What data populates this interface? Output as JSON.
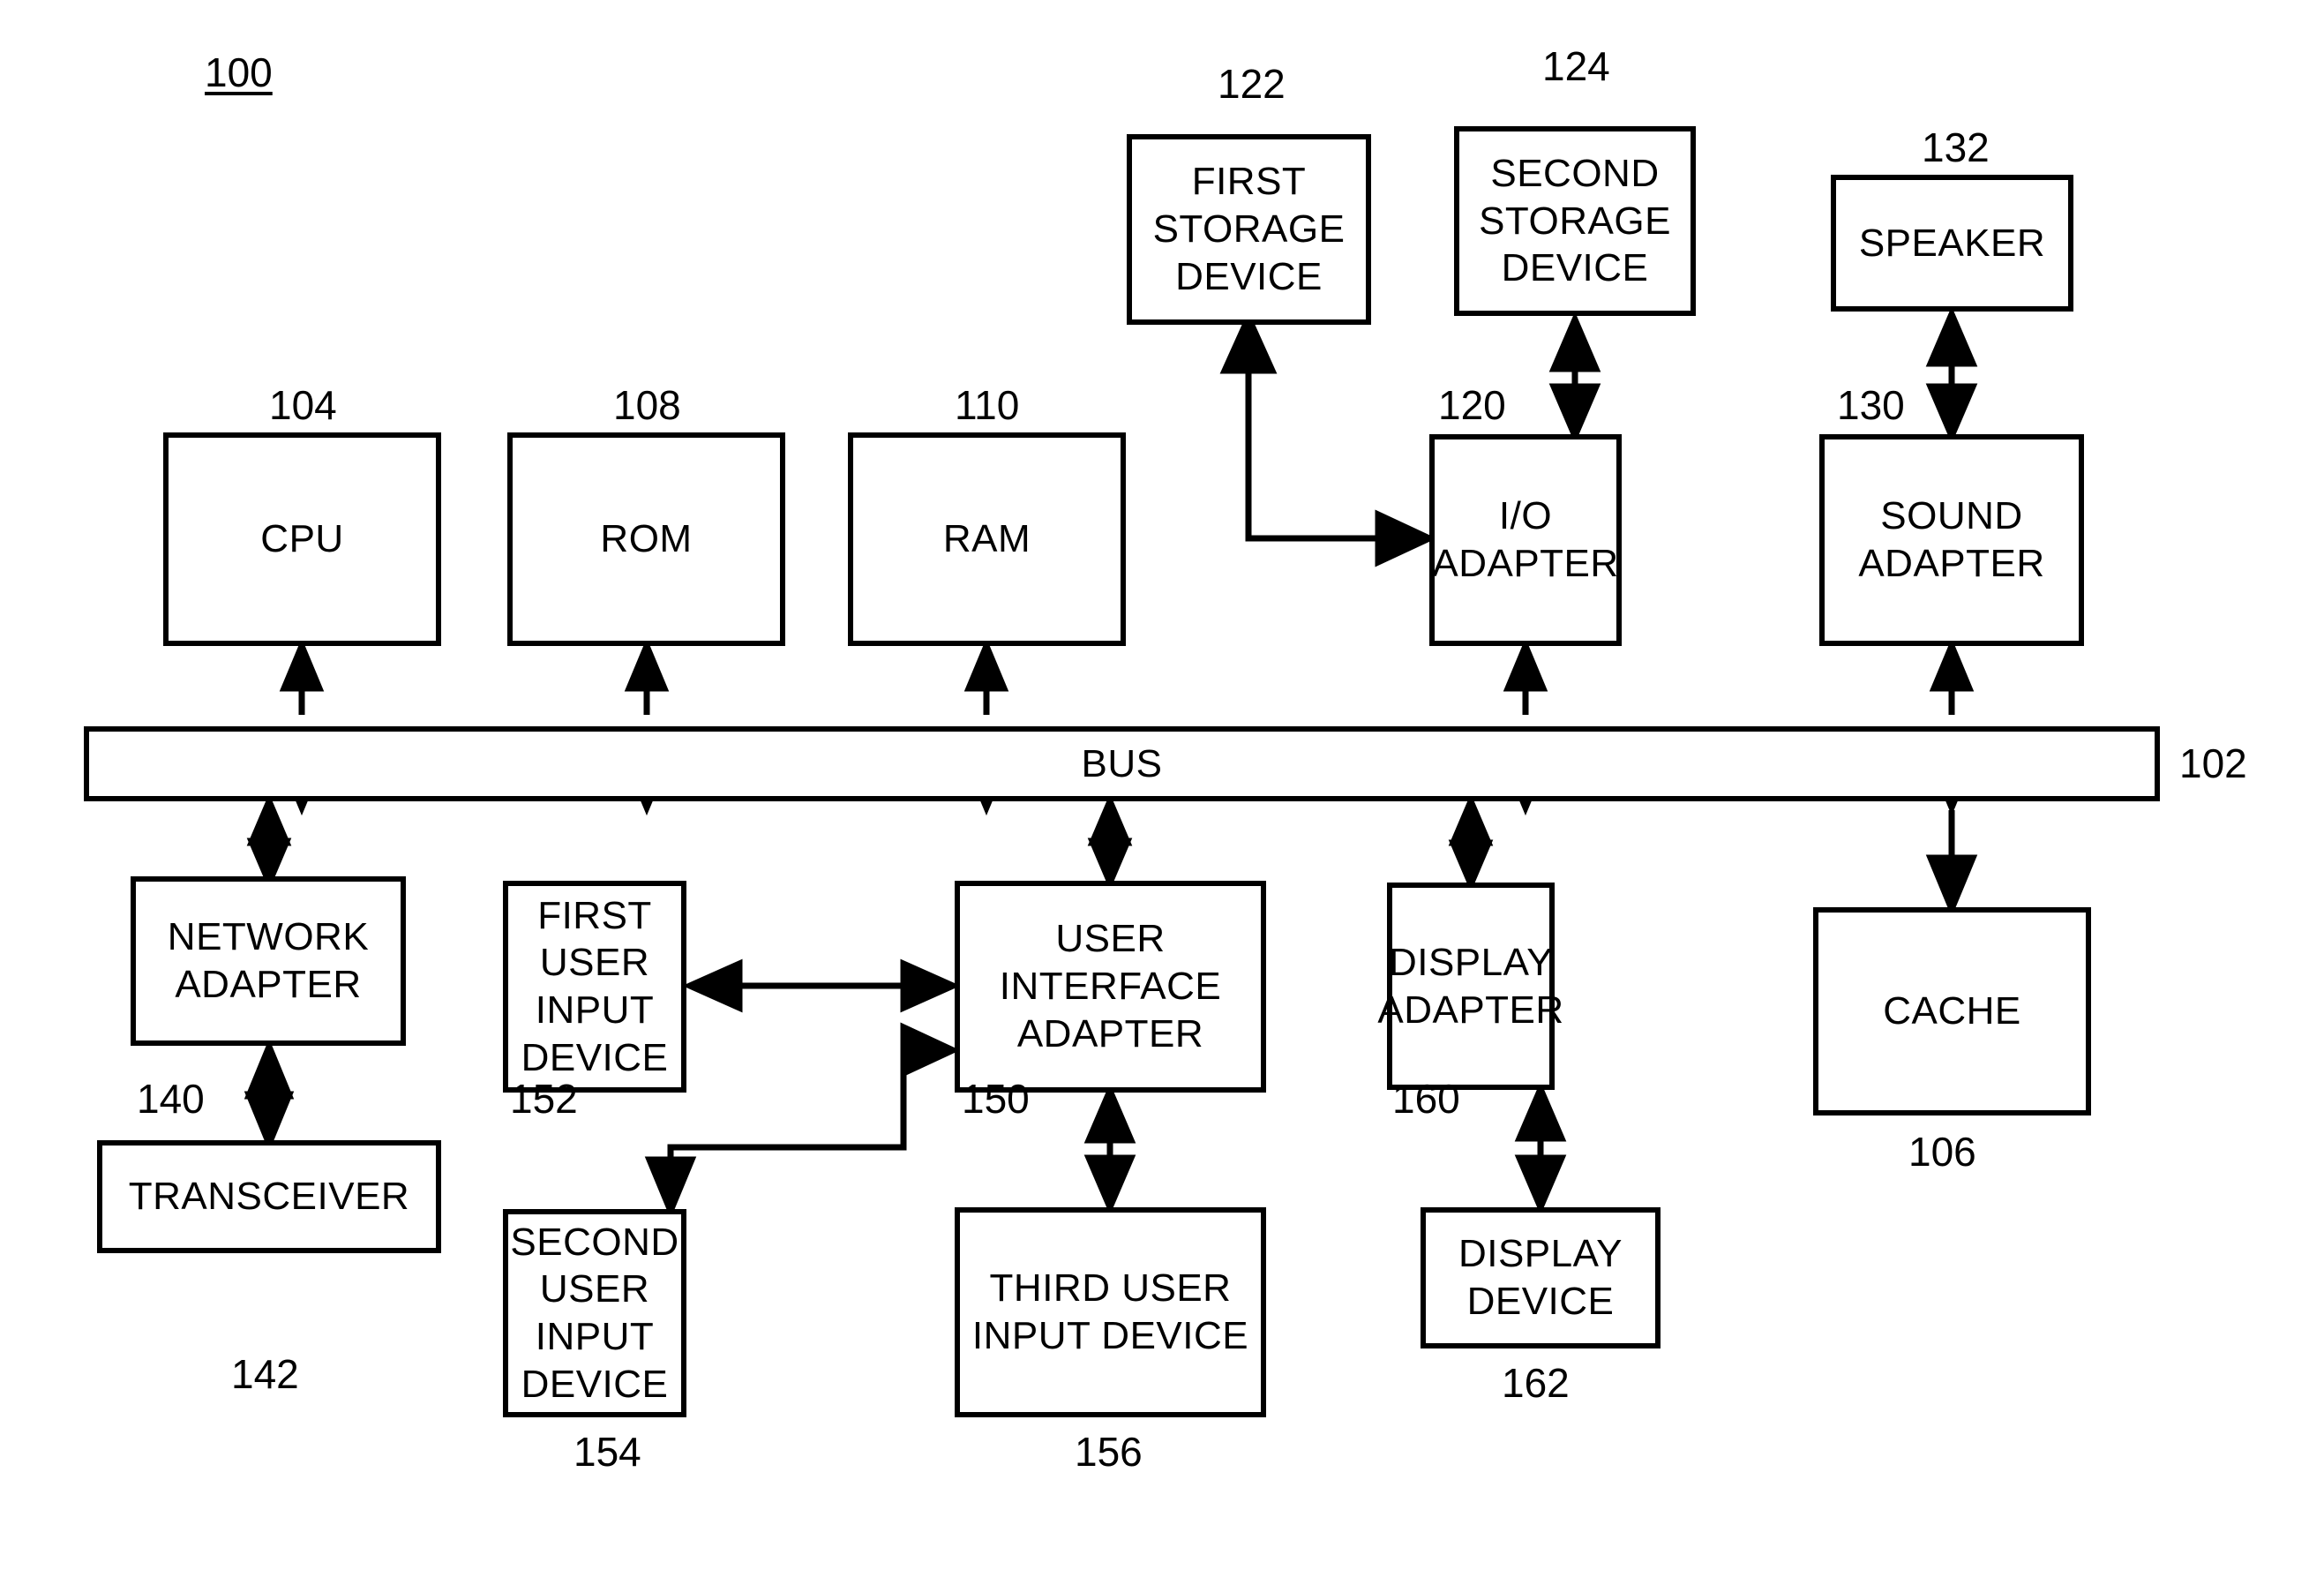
{
  "figure": {
    "figure_label": "100",
    "background_color": "#ffffff",
    "line_color": "#000000"
  },
  "nodes": {
    "first_storage_device": "FIRST\nSTORAGE\nDEVICE",
    "second_storage_device": "SECOND\nSTORAGE\nDEVICE",
    "speaker": "SPEAKER",
    "cpu": "CPU",
    "rom": "ROM",
    "ram": "RAM",
    "io_adapter": "I/O\nADAPTER",
    "sound_adapter": "SOUND\nADAPTER",
    "bus": "BUS",
    "network_adapter": "NETWORK\nADAPTER",
    "first_user_input_device": "FIRST USER\nINPUT DEVICE",
    "user_interface_adapter": "USER\nINTERFACE\nADAPTER",
    "display_adapter": "DISPLAY\nADAPTER",
    "cache": "CACHE",
    "transceiver": "TRANSCEIVER",
    "second_user_input_device": "SECOND USER\nINPUT DEVICE",
    "third_user_input_device": "THIRD USER\nINPUT DEVICE",
    "display_device": "DISPLAY\nDEVICE"
  },
  "refs": {
    "first_storage_device": "122",
    "second_storage_device": "124",
    "speaker": "132",
    "cpu": "104",
    "rom": "108",
    "ram": "110",
    "io_adapter": "120",
    "sound_adapter": "130",
    "bus": "102",
    "network_adapter": "140",
    "first_user_input_device": "152",
    "user_interface_adapter": "150",
    "display_adapter": "160",
    "cache": "106",
    "transceiver": "142",
    "second_user_input_device": "154",
    "third_user_input_device": "156",
    "display_device": "162"
  }
}
